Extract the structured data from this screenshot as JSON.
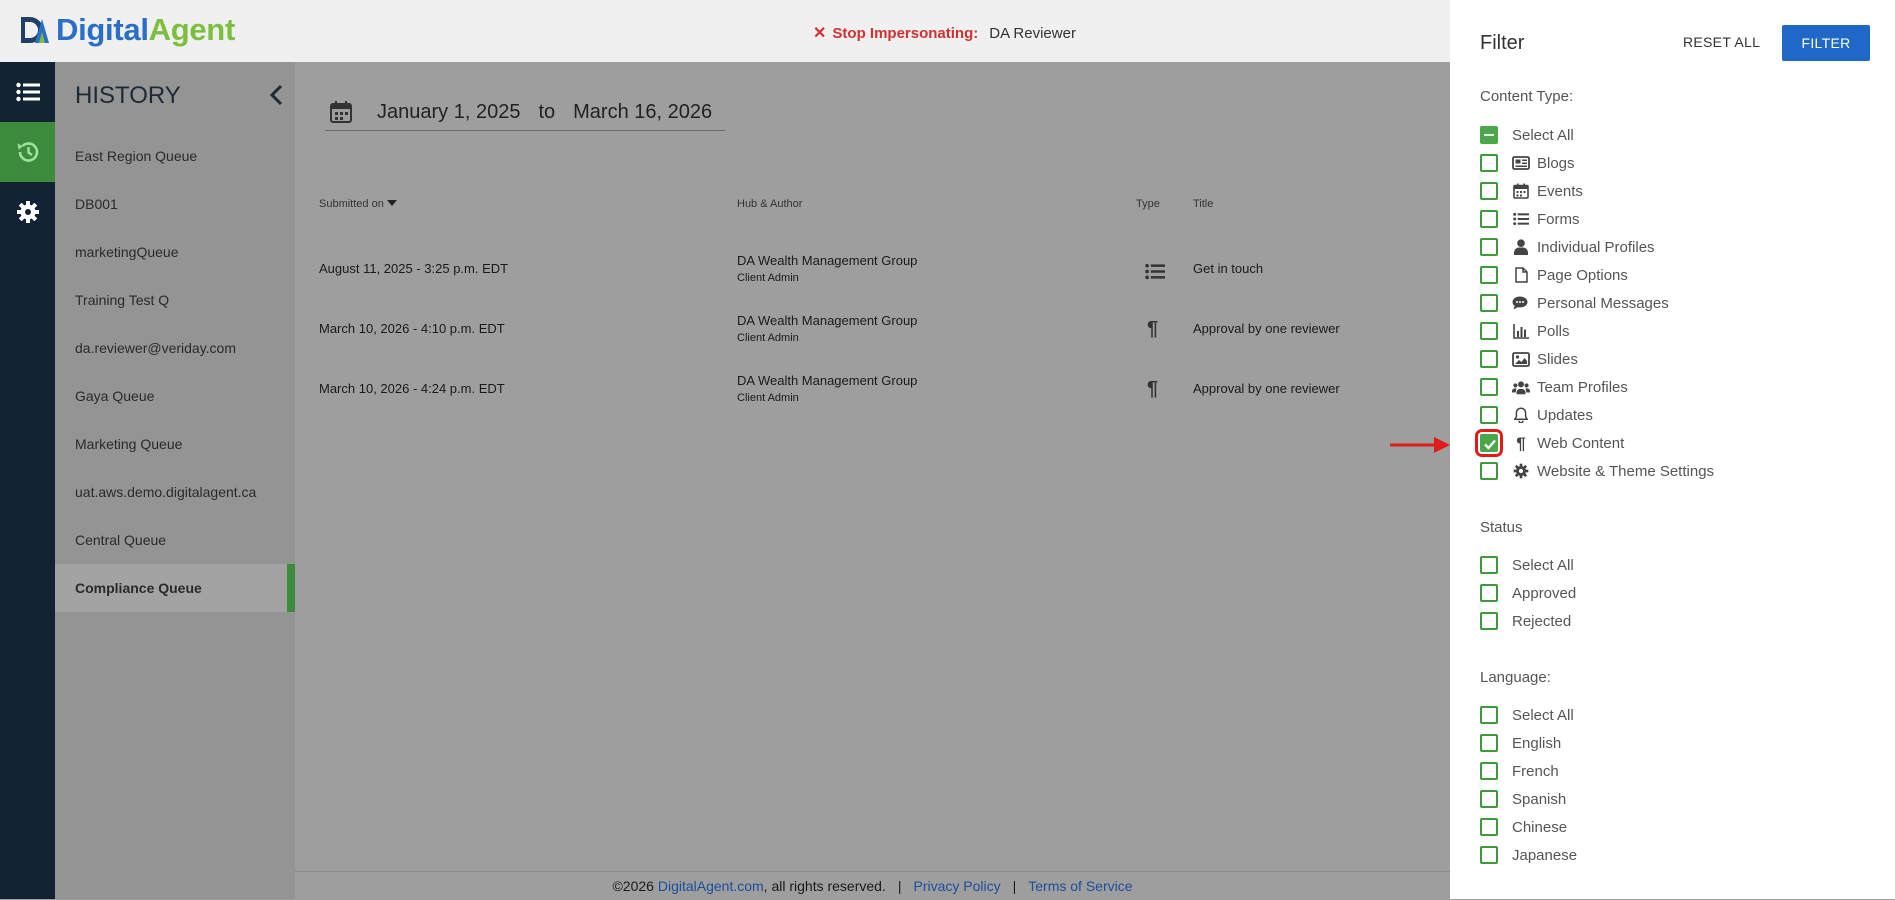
{
  "header": {
    "logo_digital": "Digital",
    "logo_agent": "Agent",
    "impersonation_label": "Stop Impersonating:",
    "impersonated_user": "DA Reviewer"
  },
  "rail": {
    "items": [
      "list-icon",
      "history-icon",
      "gear-icon"
    ],
    "active_index": 1
  },
  "history": {
    "title": "HISTORY",
    "items": [
      {
        "label": "East Region Queue"
      },
      {
        "label": "DB001"
      },
      {
        "label": "marketingQueue"
      },
      {
        "label": "Training Test Q"
      },
      {
        "label": "da.reviewer@veriday.com"
      },
      {
        "label": "Gaya Queue"
      },
      {
        "label": "Marketing Queue"
      },
      {
        "label": "uat.aws.demo.digitalagent.ca"
      },
      {
        "label": "Central Queue"
      },
      {
        "label": "Compliance Queue"
      }
    ],
    "active_index": 9
  },
  "date_range": {
    "from": "January 1, 2025",
    "to_label": "to",
    "to": "March 16, 2026"
  },
  "table": {
    "headers": {
      "submitted": "Submitted on",
      "hub": "Hub & Author",
      "type": "Type",
      "title": "Title"
    },
    "rows": [
      {
        "submitted": "August 11, 2025 - 3:25 p.m. EDT",
        "hub": "DA Wealth Management Group",
        "author": "Client Admin",
        "type_icon": "list-icon",
        "title": "Get in touch"
      },
      {
        "submitted": "March 10, 2026 - 4:10 p.m. EDT",
        "hub": "DA Wealth Management Group",
        "author": "Client Admin",
        "type_icon": "pilcrow-icon",
        "title": "Approval by one reviewer"
      },
      {
        "submitted": "March 10, 2026 - 4:24 p.m. EDT",
        "hub": "DA Wealth Management Group",
        "author": "Client Admin",
        "type_icon": "pilcrow-icon",
        "title": "Approval by one reviewer"
      }
    ]
  },
  "footer": {
    "copyright": "©2026",
    "site": "DigitalAgent.com",
    "rights": ", all rights reserved.",
    "sep": "|",
    "privacy": "Privacy Policy",
    "terms": "Terms of Service"
  },
  "filter": {
    "title": "Filter",
    "reset_label": "RESET ALL",
    "filter_label": "FILTER",
    "content_type": {
      "label": "Content Type:",
      "options": [
        {
          "label": "Select All",
          "state": "indeterminate",
          "icon": ""
        },
        {
          "label": "Blogs",
          "state": "unchecked",
          "icon": "newspaper-icon"
        },
        {
          "label": "Events",
          "state": "unchecked",
          "icon": "calendar-icon"
        },
        {
          "label": "Forms",
          "state": "unchecked",
          "icon": "list-icon"
        },
        {
          "label": "Individual Profiles",
          "state": "unchecked",
          "icon": "user-icon"
        },
        {
          "label": "Page Options",
          "state": "unchecked",
          "icon": "file-icon"
        },
        {
          "label": "Personal Messages",
          "state": "unchecked",
          "icon": "comments-icon"
        },
        {
          "label": "Polls",
          "state": "unchecked",
          "icon": "bar-chart-icon"
        },
        {
          "label": "Slides",
          "state": "unchecked",
          "icon": "image-icon"
        },
        {
          "label": "Team Profiles",
          "state": "unchecked",
          "icon": "users-icon"
        },
        {
          "label": "Updates",
          "state": "unchecked",
          "icon": "bell-icon"
        },
        {
          "label": "Web Content",
          "state": "checked",
          "icon": "pilcrow-icon"
        },
        {
          "label": "Website & Theme Settings",
          "state": "unchecked",
          "icon": "gear-icon"
        }
      ]
    },
    "status": {
      "label": "Status",
      "options": [
        {
          "label": "Select All",
          "state": "unchecked"
        },
        {
          "label": "Approved",
          "state": "unchecked"
        },
        {
          "label": "Rejected",
          "state": "unchecked"
        }
      ]
    },
    "language": {
      "label": "Language:",
      "options": [
        {
          "label": "Select All",
          "state": "unchecked"
        },
        {
          "label": "English",
          "state": "unchecked"
        },
        {
          "label": "French",
          "state": "unchecked"
        },
        {
          "label": "Spanish",
          "state": "unchecked"
        },
        {
          "label": "Chinese",
          "state": "unchecked"
        },
        {
          "label": "Japanese",
          "state": "unchecked"
        }
      ]
    }
  },
  "annotation": {
    "color": "#e01b1b",
    "target": "Web Content"
  },
  "colors": {
    "accent_green": "#3d9a3d",
    "primary_blue": "#1f68c7",
    "danger_red": "#d32f2f",
    "rail_bg": "#122334"
  }
}
